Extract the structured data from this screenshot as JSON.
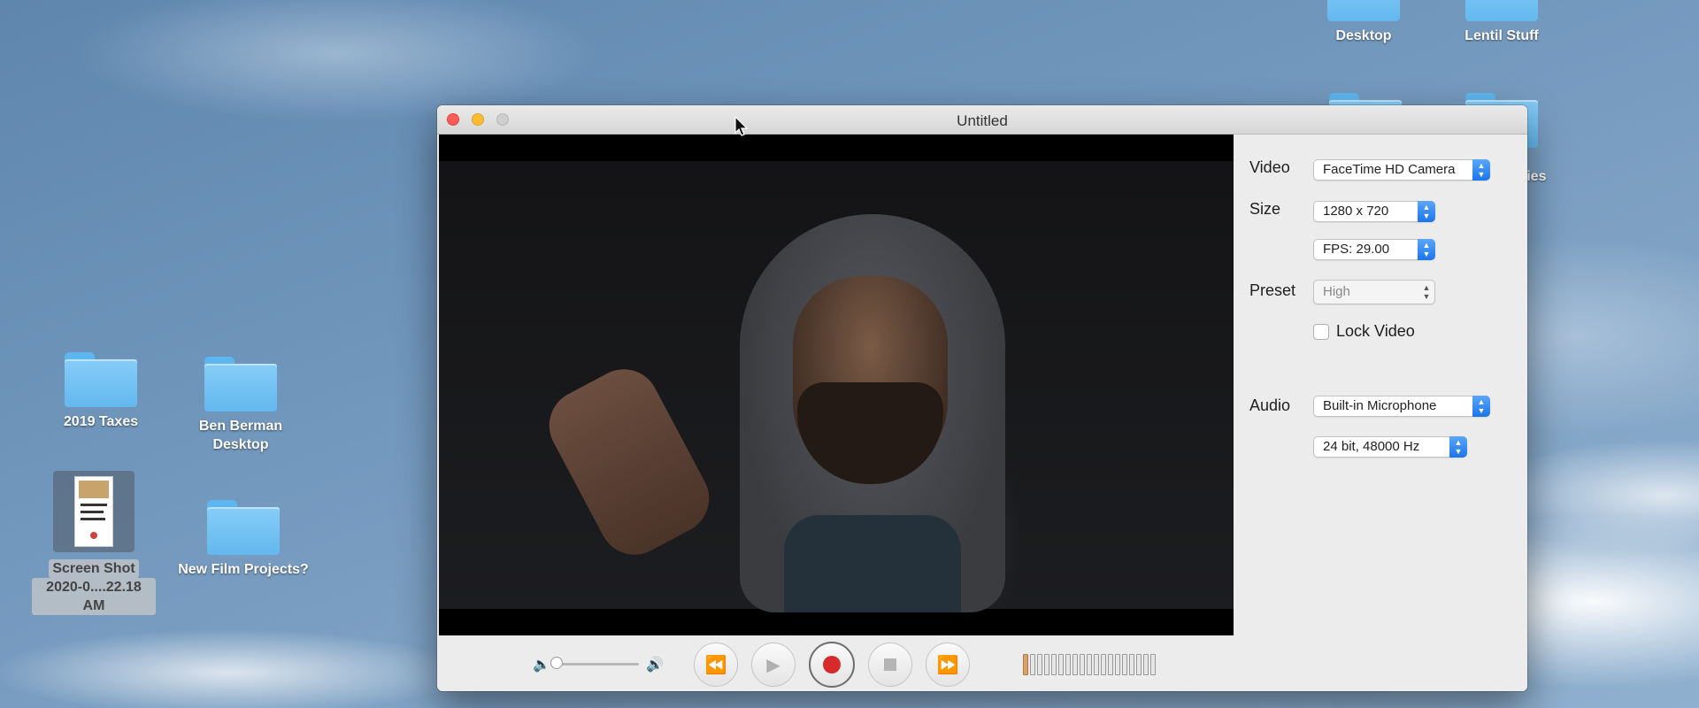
{
  "desktop": {
    "items_top": [
      {
        "label": "Desktop"
      },
      {
        "label": "Lentil Stuff"
      }
    ],
    "items_left": [
      {
        "label": "2019 Taxes"
      },
      {
        "label": "Ben Berman Desktop"
      },
      {
        "label": "New Film Projects?"
      }
    ],
    "screenshot_file": {
      "line1": "Screen Shot",
      "line2": "2020-0....22.18 AM"
    },
    "partial_label": "ries"
  },
  "window": {
    "title": "Untitled",
    "panel": {
      "video_label": "Video",
      "video_value": "FaceTime HD Camera",
      "size_label": "Size",
      "size_value": "1280 x 720",
      "fps_value": "FPS: 29.00",
      "preset_label": "Preset",
      "preset_value": "High",
      "lock_label": "Lock Video",
      "lock_checked": false,
      "audio_label": "Audio",
      "audio_value": "Built-in Microphone",
      "audio_format": "24 bit, 48000 Hz"
    },
    "controls": {
      "volume_level": 0.02,
      "meter_segments": 19,
      "meter_lit": 1
    }
  },
  "icons": {
    "close": "close-dot",
    "minimize": "minimize-dot",
    "zoom": "zoom-dot",
    "rewind": "rewind-icon",
    "play": "play-icon",
    "record": "record-icon",
    "stop": "stop-icon",
    "fast_forward": "fast-forward-icon"
  },
  "colors": {
    "accent": "#1b76ec",
    "record": "#d72a2a",
    "close": "#fd5b57",
    "minimize": "#febc2e"
  }
}
